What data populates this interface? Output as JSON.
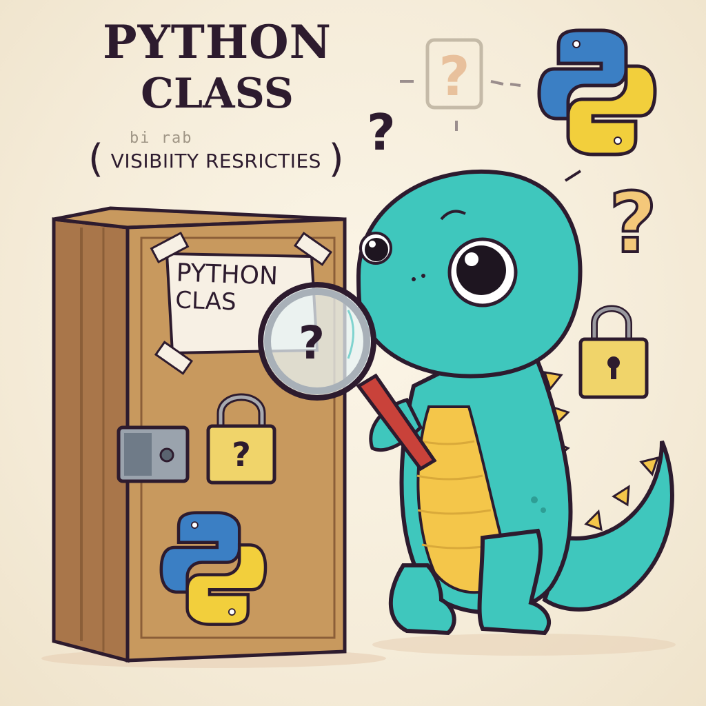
{
  "title": {
    "line1": "PYTHON",
    "line2": "CLASS"
  },
  "faded_text": "bi   rab",
  "subtitle": {
    "open": "(",
    "text": "VISIBIITY RESRICTIES",
    "close": ")"
  },
  "question_mark": "?",
  "box_label": {
    "line1": "PYTHON",
    "line2": "CLAS"
  },
  "colors": {
    "background": "#f5ecd9",
    "ink": "#2d1b2e",
    "cabinet": "#c8995e",
    "dino": "#3fc7bd",
    "belly": "#f4c64a",
    "lock": "#f0d46a",
    "python_blue": "#3b7fc4",
    "python_yellow": "#f2cf3c"
  }
}
